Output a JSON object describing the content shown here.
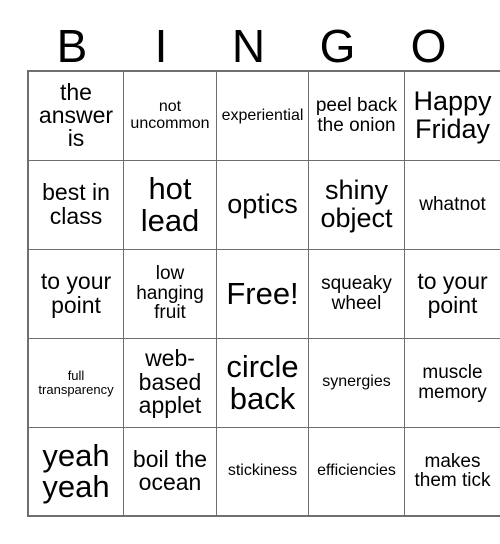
{
  "card": {
    "title_letters": [
      "B",
      "I",
      "N",
      "G",
      "O"
    ],
    "columns": 5,
    "rows": 5,
    "grid_border_color": "#6e6e6e",
    "text_color": "#000000",
    "background_color": "#ffffff",
    "cells": [
      [
        {
          "text": "the answer is",
          "size": "sz-l"
        },
        {
          "text": "not uncommon",
          "size": "sz-s"
        },
        {
          "text": "experiential",
          "size": "sz-s"
        },
        {
          "text": "peel back the onion",
          "size": "sz-m"
        },
        {
          "text": "Happy Friday",
          "size": "sz-xl"
        }
      ],
      [
        {
          "text": "best in class",
          "size": "sz-l"
        },
        {
          "text": "hot lead",
          "size": "sz-xxl"
        },
        {
          "text": "optics",
          "size": "sz-xl"
        },
        {
          "text": "shiny object",
          "size": "sz-xl"
        },
        {
          "text": "whatnot",
          "size": "sz-m"
        }
      ],
      [
        {
          "text": "to your point",
          "size": "sz-l"
        },
        {
          "text": "low hanging fruit",
          "size": "sz-m"
        },
        {
          "text": "Free!",
          "size": "sz-xxl"
        },
        {
          "text": "squeaky wheel",
          "size": "sz-m"
        },
        {
          "text": "to your point",
          "size": "sz-l"
        }
      ],
      [
        {
          "text": "full transparency",
          "size": "sz-xs"
        },
        {
          "text": "web-based applet",
          "size": "sz-l"
        },
        {
          "text": "circle back",
          "size": "sz-xxl"
        },
        {
          "text": "synergies",
          "size": "sz-s"
        },
        {
          "text": "muscle memory",
          "size": "sz-m"
        }
      ],
      [
        {
          "text": "yeah yeah",
          "size": "sz-xxl"
        },
        {
          "text": "boil the ocean",
          "size": "sz-l"
        },
        {
          "text": "stickiness",
          "size": "sz-s"
        },
        {
          "text": "efficiencies",
          "size": "sz-s"
        },
        {
          "text": "makes them tick",
          "size": "sz-m"
        }
      ]
    ]
  }
}
